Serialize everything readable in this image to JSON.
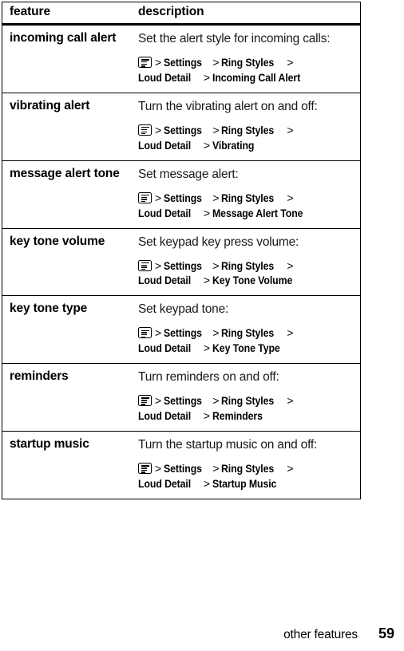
{
  "page": {
    "footer_label": "other features",
    "page_number": "59"
  },
  "table": {
    "headers": {
      "feature": "feature",
      "description": "description"
    },
    "rows": [
      {
        "feature": "incoming call alert",
        "lead": "Set the alert style for incoming calls:",
        "icon": "menu-icon",
        "path": [
          "Settings",
          "Ring Styles",
          "Loud Detail",
          "Incoming Call Alert"
        ]
      },
      {
        "feature": "vibrating alert",
        "lead": "Turn the vibrating alert on and off:",
        "icon": "menu-icon",
        "path": [
          "Settings",
          "Ring Styles",
          "Loud Detail",
          "Vibrating"
        ]
      },
      {
        "feature": "message alert tone",
        "lead": "Set message alert:",
        "icon": "menu-icon",
        "path": [
          "Settings",
          "Ring Styles",
          "Loud Detail",
          "Message Alert Tone"
        ]
      },
      {
        "feature": "key tone volume",
        "lead": "Set keypad key press volume:",
        "icon": "menu-icon",
        "path": [
          "Settings",
          "Ring Styles",
          "Loud Detail",
          "Key Tone Volume"
        ]
      },
      {
        "feature": "key tone type",
        "lead": "Set keypad tone:",
        "icon": "menu-icon",
        "path": [
          "Settings",
          "Ring Styles",
          "Loud Detail",
          "Key Tone Type"
        ]
      },
      {
        "feature": "reminders",
        "lead": "Turn reminders on and off:",
        "icon": "menu-icon",
        "path": [
          "Settings",
          "Ring Styles",
          "Loud Detail",
          "Reminders"
        ]
      },
      {
        "feature": "startup music",
        "lead": "Turn the startup music on and off:",
        "icon": "menu-icon",
        "path": [
          "Settings",
          "Ring Styles",
          "Loud Detail",
          "Startup Music"
        ]
      }
    ],
    "path_separator": ">"
  },
  "colors": {
    "ink": "#000000",
    "paper": "#ffffff"
  }
}
